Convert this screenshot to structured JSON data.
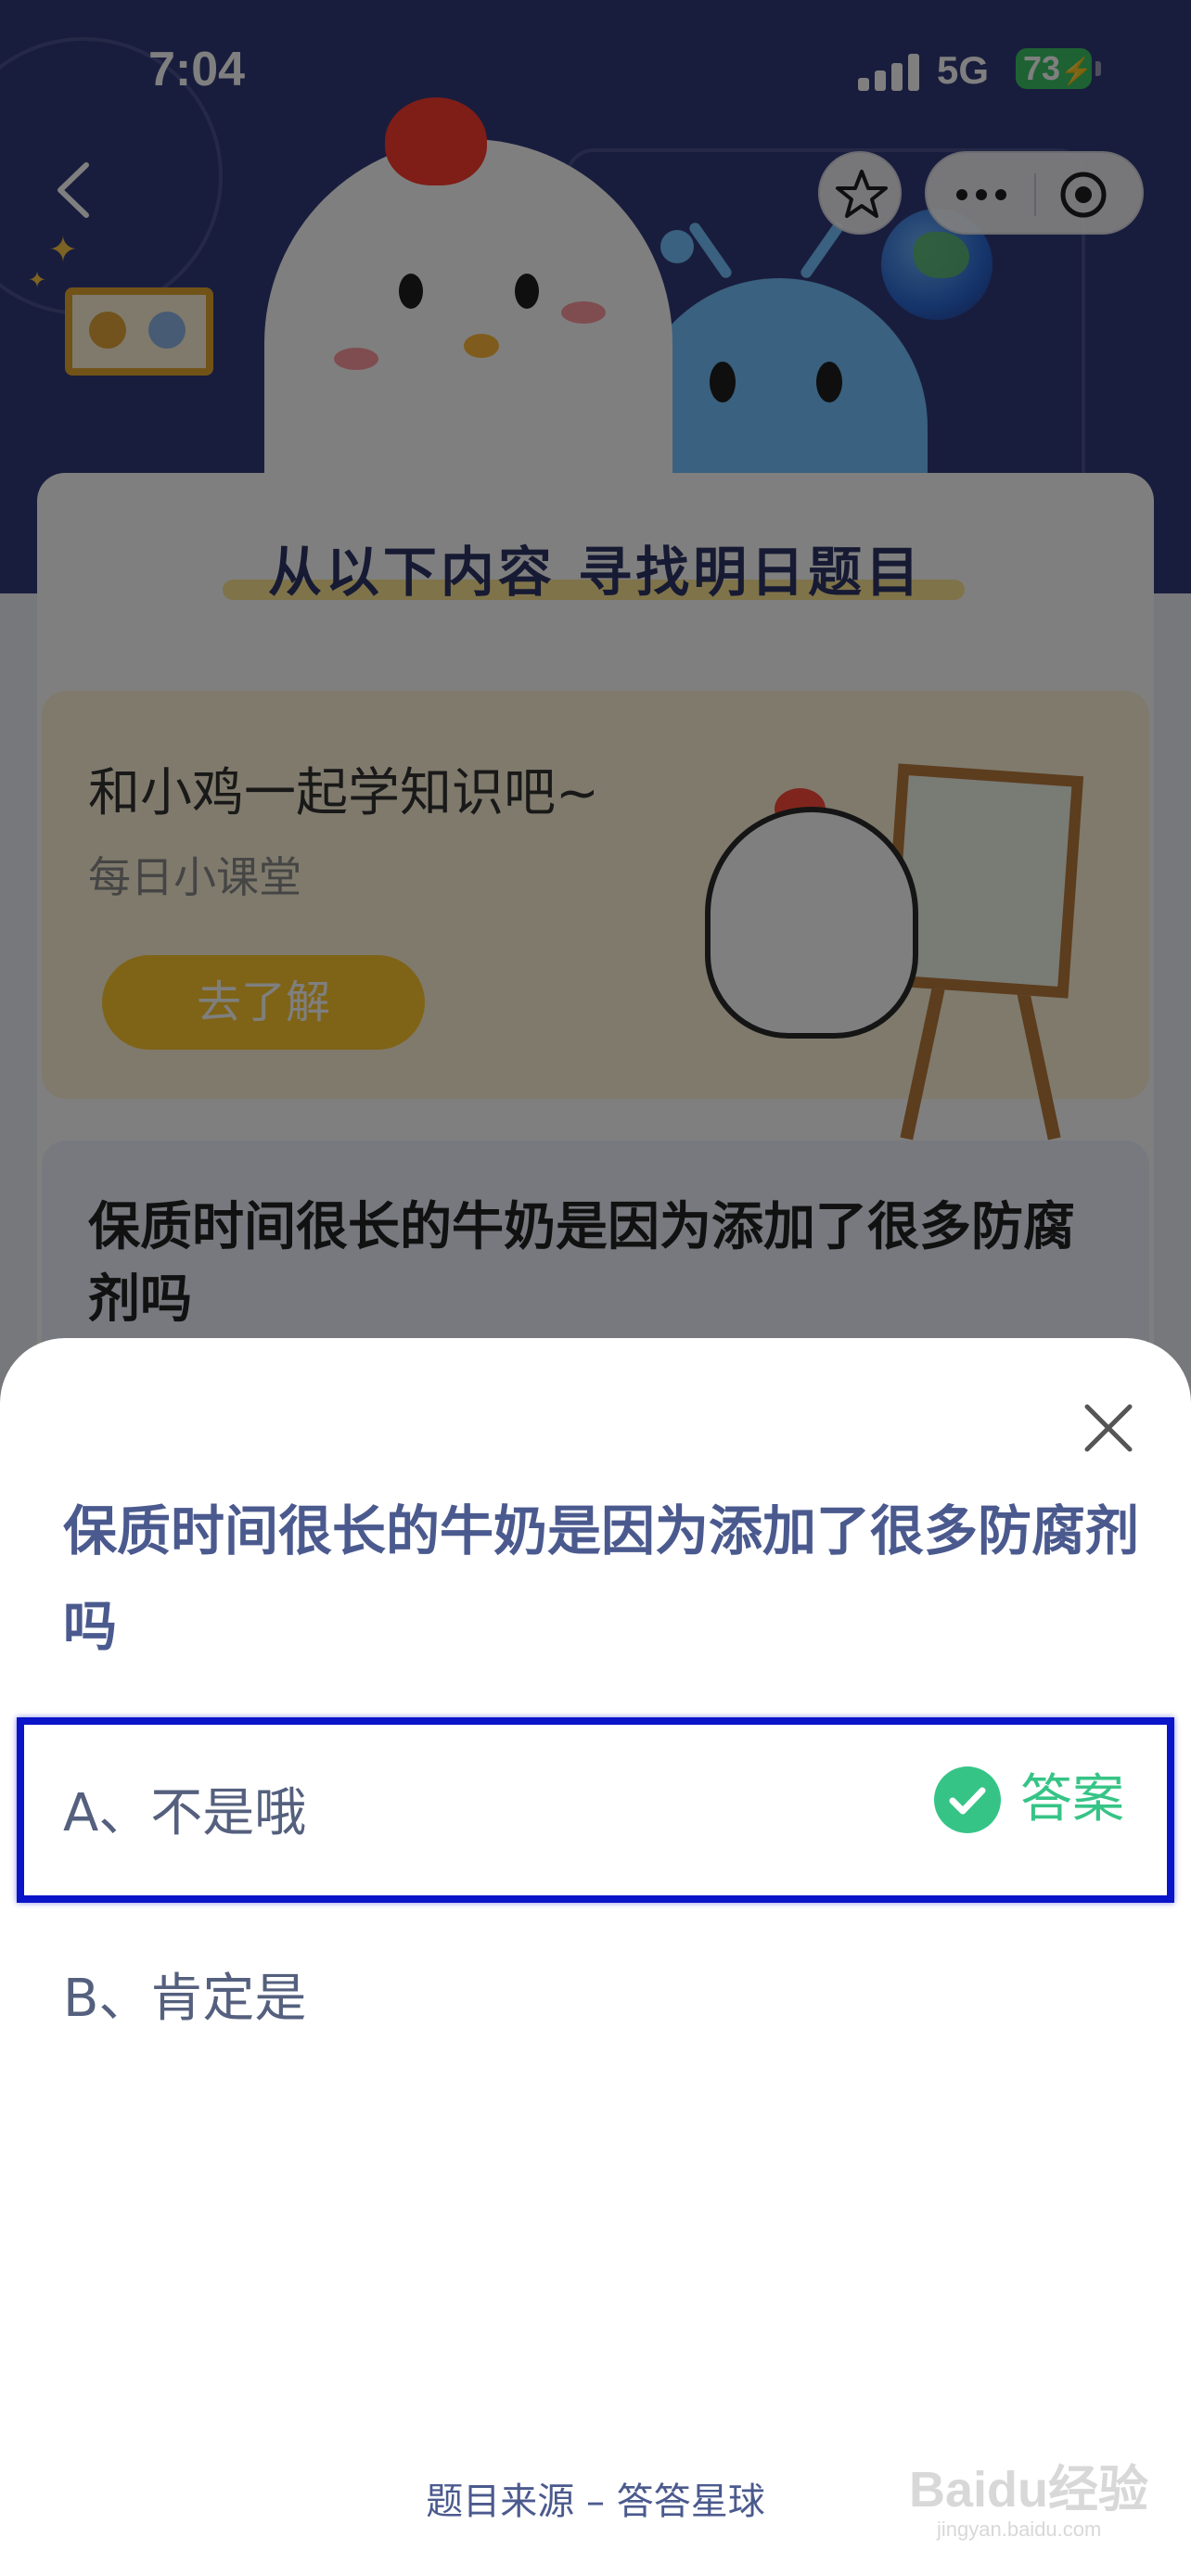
{
  "status_bar": {
    "time": "7:04",
    "network": "5G",
    "battery": "73"
  },
  "page": {
    "section_title": "从以下内容 寻找明日题目",
    "learn_card": {
      "title": "和小鸡一起学知识吧~",
      "subtitle": "每日小课堂",
      "button": "去了解"
    },
    "question_card": {
      "title": "保质时间很长的牛奶是因为添加了很多防腐剂吗"
    }
  },
  "sheet": {
    "question": "保质时间很长的牛奶是因为添加了很多防腐剂吗",
    "options": [
      {
        "label": "A、不是哦",
        "is_answer": true,
        "answer_tag": "答案"
      },
      {
        "label": "B、肯定是",
        "is_answer": false
      }
    ],
    "source": "题目来源 – 答答星球"
  },
  "watermark": {
    "text": "Baidu经验",
    "sub": "jingyan.baidu.com"
  },
  "colors": {
    "answer_green": "#36c486",
    "highlight_blue": "#0a14c8",
    "question_text": "#4b5a8e"
  },
  "icons": [
    "chevron-left-icon",
    "star-icon",
    "more-dots-icon",
    "target-icon",
    "close-icon",
    "check-icon"
  ]
}
